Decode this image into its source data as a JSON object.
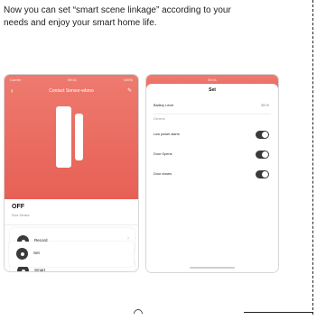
{
  "intro": {
    "line1": "Now you can set “smart scene linkage” according to your",
    "line2": "needs and enjoy your smart home life."
  },
  "left_phone": {
    "status_left": "Carrier",
    "status_center": "09:41",
    "status_right": "100%",
    "title": "Contact Sensor-wbmo",
    "back_icon": "chevron-left-icon",
    "edit_icon": "pencil-icon",
    "state_label": "OFF",
    "state_sub": "Door Sensor",
    "rows": [
      {
        "label": "Record",
        "sub": "No Record",
        "icon": "record-icon"
      },
      {
        "label": "Smart",
        "sub": "",
        "icon": "smart-icon"
      },
      {
        "label": "Set",
        "sub": "",
        "icon": "settings-icon"
      }
    ],
    "accent_color": "#e9685c"
  },
  "right_phone": {
    "status_center": "09:41",
    "title": "Set",
    "battery_label": "Battery Level",
    "battery_value": "85 %",
    "section_label": "General",
    "toggles": [
      {
        "label": "Low power alarm",
        "on": true
      },
      {
        "label": "Door Opens",
        "on": true
      },
      {
        "label": "Door closes",
        "on": true
      }
    ],
    "accent_color": "#e9685c"
  }
}
